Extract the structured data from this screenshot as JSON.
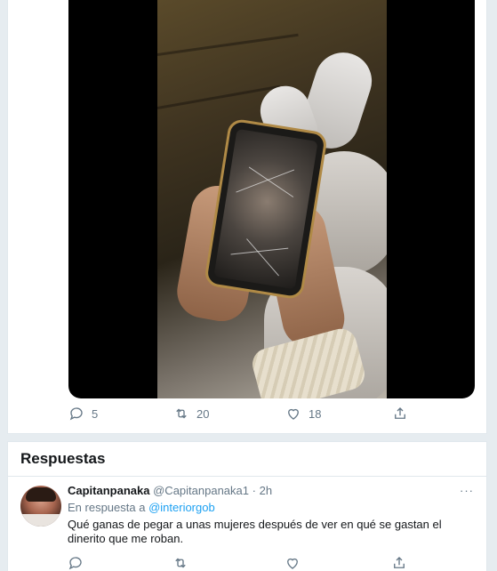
{
  "tweet": {
    "actions": {
      "reply_count": "5",
      "retweet_count": "20",
      "like_count": "18"
    }
  },
  "replies_section": {
    "title": "Respuestas"
  },
  "reply": {
    "display_name": "Capitanpanaka",
    "handle": "@Capitanpanaka1",
    "separator": "·",
    "time": "2h",
    "more_label": "···",
    "in_reply_prefix": "En respuesta a",
    "in_reply_handle": "@interiorgob",
    "text": "Qué ganas de pegar a unas mujeres después de ver en qué se gastan el dinerito que me roban."
  },
  "colors": {
    "accent": "#1da1f2",
    "secondary_text": "#657786",
    "background": "#e6ecf0"
  },
  "icons": [
    "reply-icon",
    "retweet-icon",
    "like-icon",
    "share-icon",
    "more-icon"
  ]
}
